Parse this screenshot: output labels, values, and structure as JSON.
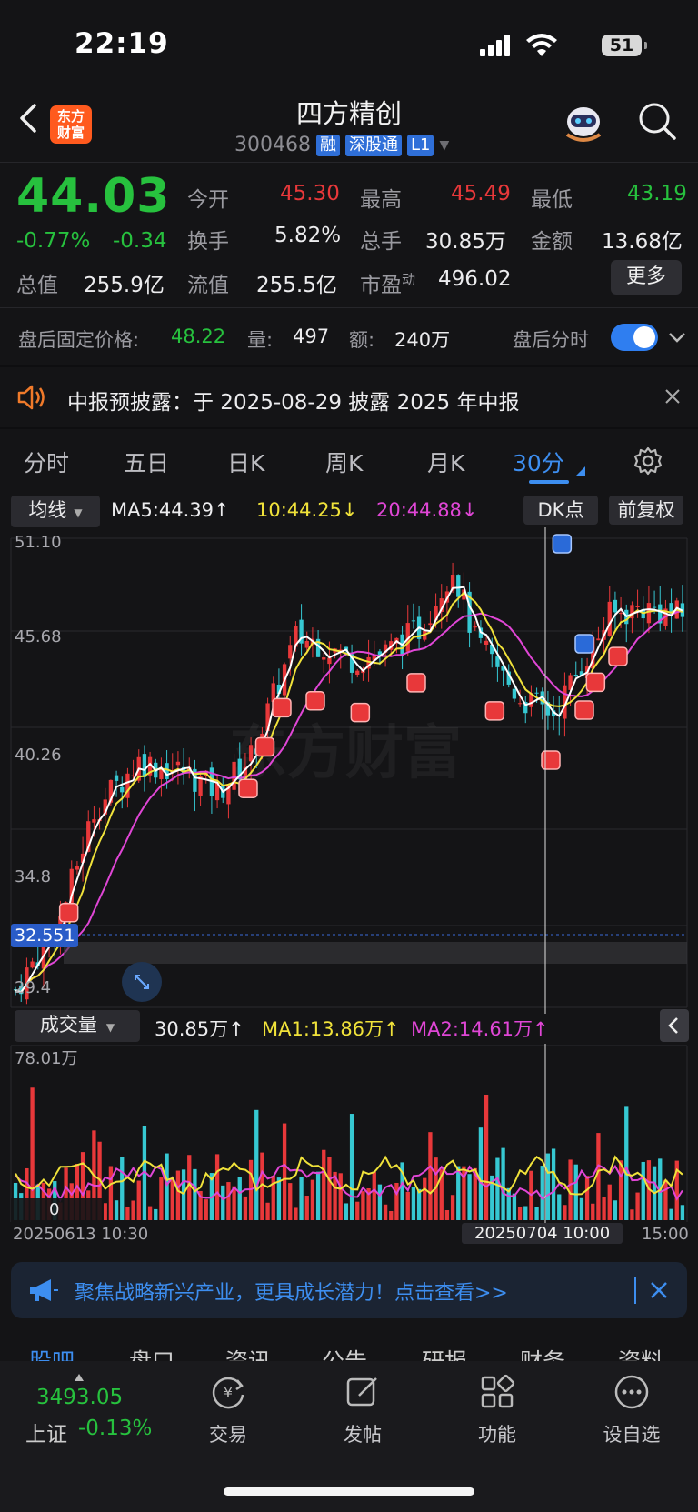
{
  "status_bar": {
    "time": "22:19",
    "battery": "51"
  },
  "header": {
    "title": "四方精创",
    "code": "300468",
    "tags": [
      "融",
      "深股通",
      "L1"
    ],
    "logo_text": "东方\n财富"
  },
  "quote": {
    "price": "44.03",
    "change_pct": "-0.77%",
    "change": "-0.34",
    "open_label": "今开",
    "open": "45.30",
    "high_label": "最高",
    "high": "45.49",
    "low_label": "最低",
    "low": "43.19",
    "turnover_label": "换手",
    "turnover": "5.82%",
    "volume_label": "总手",
    "volume": "30.85万",
    "amount_label": "金额",
    "amount": "13.68亿",
    "total_cap_label": "总值",
    "total_cap": "255.9亿",
    "float_cap_label": "流值",
    "float_cap": "255.5亿",
    "pe_label": "市盈",
    "pe_sup": "动",
    "pe": "496.02",
    "more_label": "更多"
  },
  "after_hours": {
    "label": "盘后固定价格:",
    "price": "48.22",
    "vol_label": "量:",
    "vol": "497",
    "amt_label": "额:",
    "amt": "240万",
    "toggle_label": "盘后分时",
    "toggle_on": true
  },
  "notice": {
    "text": "中报预披露：于 2025-08-29 披露 2025 年中报"
  },
  "chart_tabs": [
    "分时",
    "五日",
    "日K",
    "周K",
    "月K",
    "30分"
  ],
  "active_tab": "30分",
  "ma_legend": {
    "selector": "均线",
    "ma5": "MA5:44.39↑",
    "ma10": "10:44.25↓",
    "ma20": "20:44.88↓",
    "dk_label": "DK点",
    "adjust_label": "前复权"
  },
  "kline_axis": {
    "ticks": [
      "51.10",
      "45.68",
      "40.26",
      "34.8",
      "29.4"
    ],
    "cursor_price": "32.551",
    "watermark": "东方财富"
  },
  "volume_legend": {
    "selector": "成交量",
    "vol": "30.85万↑",
    "ma1": "MA1:13.86万↑",
    "ma2": "MA2:14.61万↑",
    "max_tick": "78.01万",
    "zero_tick": "0"
  },
  "time_axis": {
    "start": "20250613 10:30",
    "cursor": "20250704 10:00",
    "end": "15:00"
  },
  "banner": {
    "text": "聚焦战略新兴产业，更具成长潜力！点击查看>>"
  },
  "sub_tabs": [
    "股吧",
    "盘口",
    "资讯",
    "公告",
    "研报",
    "财务",
    "资料"
  ],
  "bottom_nav": {
    "index_value": "3493.05",
    "index_name": "上证",
    "index_change": "-0.13%",
    "items": [
      "交易",
      "发帖",
      "功能",
      "设自选"
    ]
  },
  "colors": {
    "up": "#e8383a",
    "down": "#27c13e",
    "accent": "#3d8ef0",
    "ma5": "#ffffff",
    "ma10": "#f0e23a",
    "ma20": "#e046d6",
    "bar_down": "#36c8d2"
  }
}
